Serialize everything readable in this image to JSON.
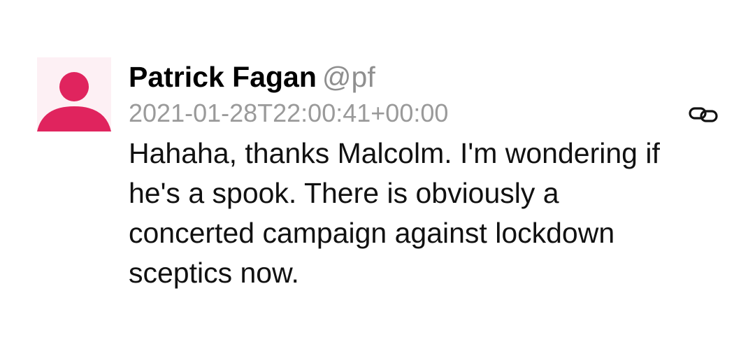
{
  "post": {
    "author": {
      "display_name": "Patrick Fagan",
      "handle": "@pf",
      "avatar_icon": "person-icon",
      "avatar_color": "#e0245e",
      "avatar_bg": "#fdf0f4"
    },
    "timestamp": "2021-01-28T22:00:41+00:00",
    "text": "Hahaha, thanks Malcolm. I'm wondering if he's a spook. There is obviously a concerted campaign against lockdown sceptics now.",
    "permalink_icon": "link-icon"
  }
}
